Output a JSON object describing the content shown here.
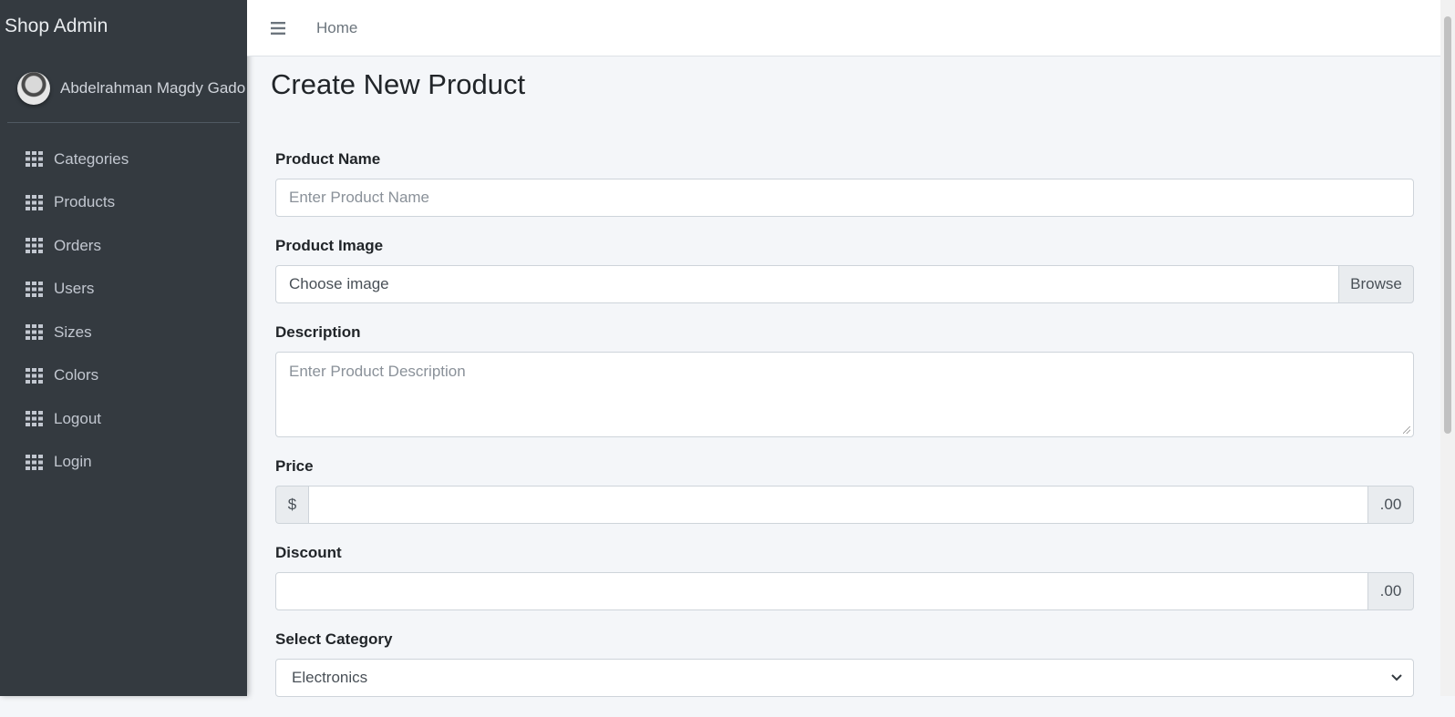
{
  "sidebar": {
    "brand": "Shop Admin",
    "user_name": "Abdelrahman Magdy Gado",
    "items": [
      {
        "label": "Categories"
      },
      {
        "label": "Products"
      },
      {
        "label": "Orders"
      },
      {
        "label": "Users"
      },
      {
        "label": "Sizes"
      },
      {
        "label": "Colors"
      },
      {
        "label": "Logout"
      },
      {
        "label": "Login"
      }
    ]
  },
  "topbar": {
    "home_label": "Home"
  },
  "page": {
    "title": "Create New Product"
  },
  "form": {
    "product_name": {
      "label": "Product Name",
      "placeholder": "Enter Product Name",
      "value": ""
    },
    "product_image": {
      "label": "Product Image",
      "value": "Choose image",
      "browse_label": "Browse"
    },
    "description": {
      "label": "Description",
      "placeholder": "Enter Product Description",
      "value": ""
    },
    "price": {
      "label": "Price",
      "prefix": "$",
      "suffix": ".00",
      "value": ""
    },
    "discount": {
      "label": "Discount",
      "suffix": ".00",
      "value": ""
    },
    "category": {
      "label": "Select Category",
      "selected": "Electronics"
    }
  },
  "icons": {
    "nav_item": "th-grid-icon",
    "menu_toggle": "hamburger-icon",
    "select_toggle": "chevron-down-icon"
  }
}
